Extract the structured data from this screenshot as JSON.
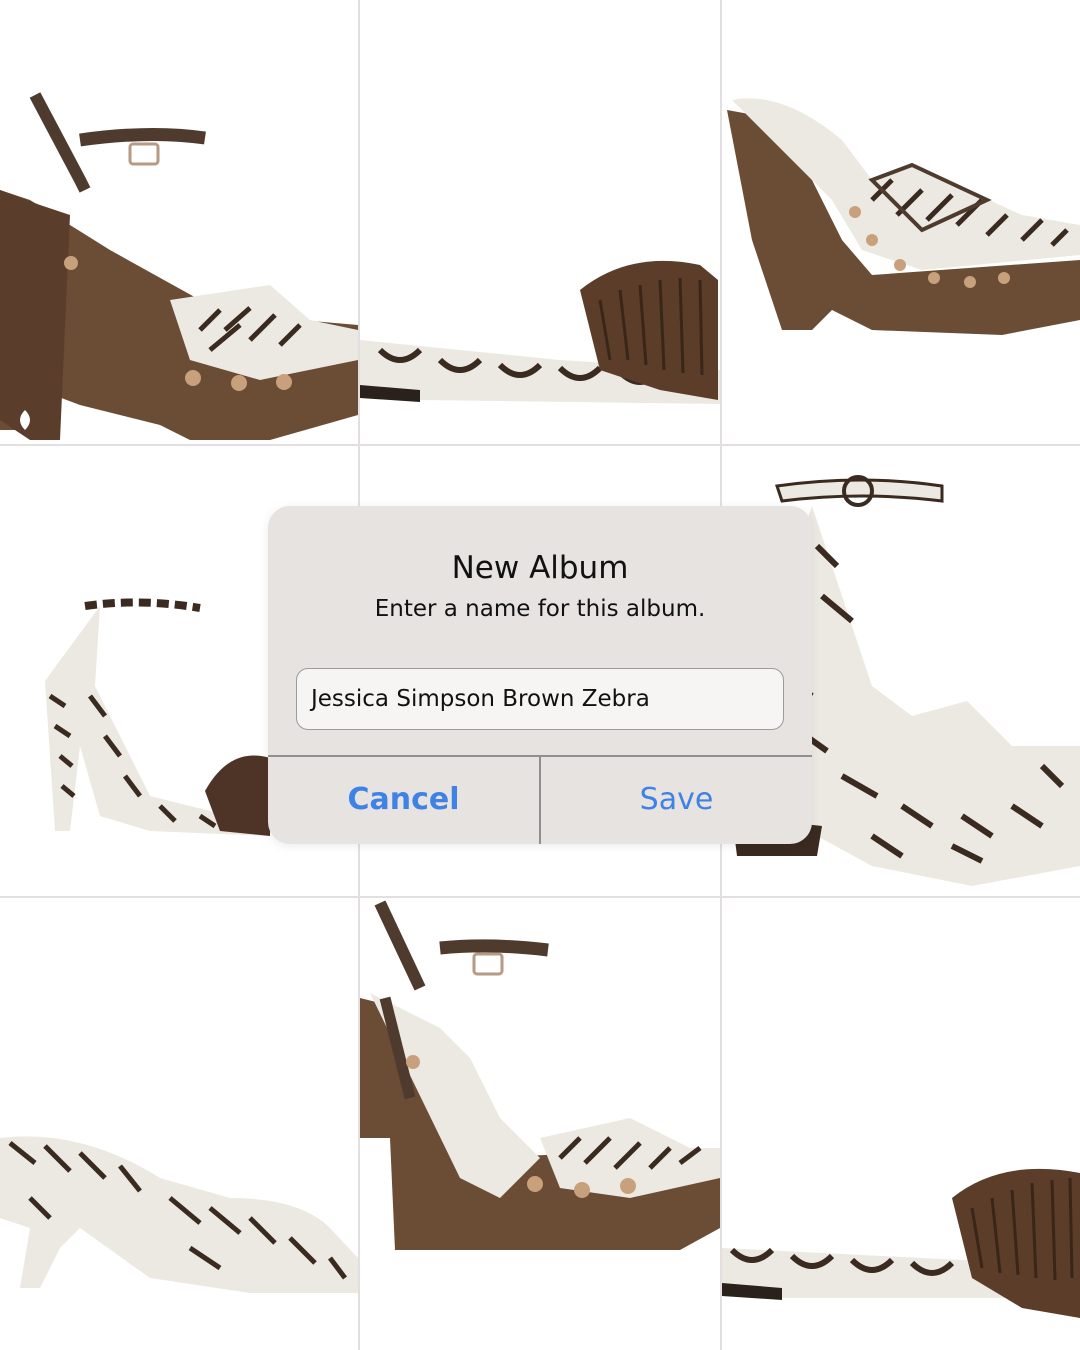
{
  "dialog": {
    "title": "New Album",
    "message": "Enter a name for this album.",
    "input_value": "Jessica Simpson Brown Zebra",
    "cancel_label": "Cancel",
    "save_label": "Save"
  },
  "colors": {
    "accent": "#3f82e6",
    "dialog_bg": "#e6e3e1",
    "grid_lines": "#e3dedf"
  },
  "photos": [
    {
      "icon": "platform-heel-sandal-image"
    },
    {
      "icon": "raffia-slide-sandal-image"
    },
    {
      "icon": "platform-mule-image"
    },
    {
      "icon": "strappy-zebra-heel-image"
    },
    {
      "icon": "zebra-photo-hidden"
    },
    {
      "icon": "zebra-platform-sandal-image"
    },
    {
      "icon": "zebra-knot-mule-image"
    },
    {
      "icon": "platform-heel-sandal-image"
    },
    {
      "icon": "raffia-slide-sandal-image"
    }
  ]
}
